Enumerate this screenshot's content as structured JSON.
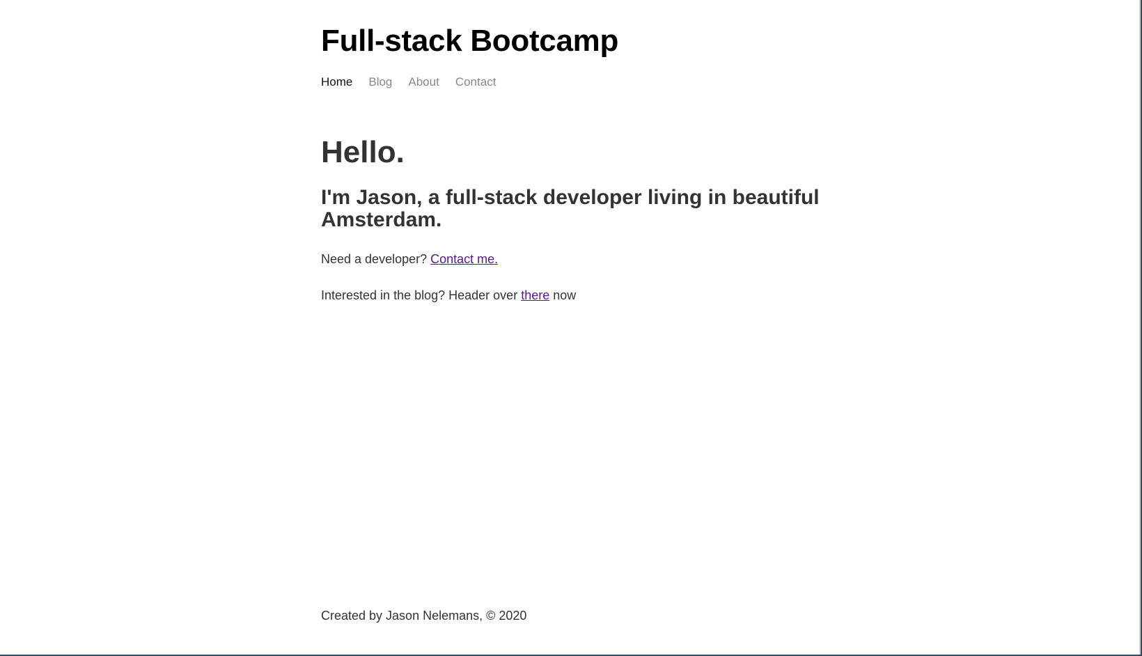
{
  "header": {
    "title": "Full-stack Bootcamp",
    "nav": [
      {
        "label": "Home",
        "active": true
      },
      {
        "label": "Blog",
        "active": false
      },
      {
        "label": "About",
        "active": false
      },
      {
        "label": "Contact",
        "active": false
      }
    ]
  },
  "main": {
    "heading": "Hello.",
    "intro": "I'm Jason, a full-stack developer living in beautiful Amsterdam.",
    "contact_line": {
      "prefix": "Need a developer? ",
      "link": "Contact me."
    },
    "blog_line": {
      "prefix": "Interested in the blog? Header over ",
      "link": "there",
      "suffix": " now"
    }
  },
  "footer": {
    "text": "Created by Jason Nelemans, © 2020"
  },
  "colors": {
    "link_visited": "#551a8b",
    "nav_inactive": "#888888",
    "text": "#333333"
  }
}
